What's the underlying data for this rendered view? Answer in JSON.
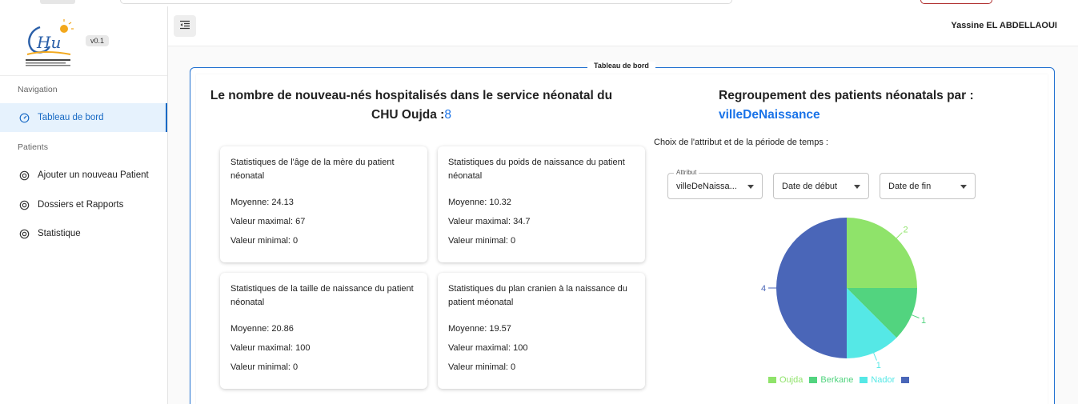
{
  "app": {
    "version": "v0.1",
    "user": "Yassine EL ABDELLAOUI"
  },
  "sidebar": {
    "section_navigation": "Navigation",
    "section_patients": "Patients",
    "items": [
      {
        "label": "Tableau de bord",
        "icon": "dashboard-icon",
        "active": true
      },
      {
        "label": "Ajouter un nouveau Patient",
        "icon": "circle-icon"
      },
      {
        "label": "Dossiers et Rapports",
        "icon": "circle-icon"
      },
      {
        "label": "Statistique",
        "icon": "circle-icon"
      }
    ]
  },
  "main": {
    "panel_title": "Tableau de bord",
    "hosp_title": "Le nombre de nouveau-nés hospitalisés dans le service néonatal du CHU Oujda :",
    "hosp_count": "8",
    "cards": [
      {
        "title": "Statistiques de l'âge de la mère du patient néonatal",
        "moyenne": "Moyenne: 24.13",
        "max": "Valeur maximal: 67",
        "min": "Valeur minimal: 0"
      },
      {
        "title": "Statistiques du poids de naissance du patient néonatal",
        "moyenne": "Moyenne: 10.32",
        "max": "Valeur maximal: 34.7",
        "min": "Valeur minimal: 0"
      },
      {
        "title": "Statistiques de la taille de naissance du patient néonatal",
        "moyenne": "Moyenne: 20.86",
        "max": "Valeur maximal: 100",
        "min": "Valeur minimal: 0"
      },
      {
        "title": "Statistiques du plan cranien à la naissance du patient méonatal",
        "moyenne": "Moyenne: 19.57",
        "max": "Valeur maximal: 100",
        "min": "Valeur minimal: 0"
      }
    ],
    "group_title": "Regroupement des patients néonatals par :",
    "group_attr": "villeDeNaissance",
    "choice_label": "Choix de l'attribut et de la période de temps :",
    "filters": {
      "attribut_label": "Attribut",
      "attribut_value": "villeDeNaissa...",
      "date_debut": "Date de début",
      "date_fin": "Date de fin"
    }
  },
  "chart_data": {
    "type": "pie",
    "categories": [
      "Oujda",
      "Berkane",
      "Nador",
      ""
    ],
    "values": [
      2,
      1,
      1,
      4
    ],
    "colors": [
      "#8fe36a",
      "#52d47f",
      "#55e8e6",
      "#4a66b8"
    ],
    "legend": "bottom"
  }
}
